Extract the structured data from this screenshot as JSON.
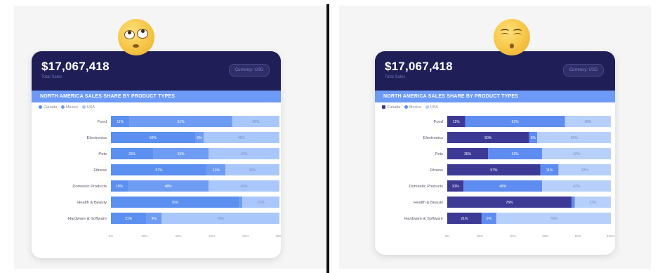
{
  "cards": [
    {
      "total": "$17,067,418",
      "total_label": "Total Sales",
      "filter_label": "Currency: USD",
      "subtitle": "NORTH AMERICA SALES SHARE BY PRODUCT TYPES",
      "legend": [
        "Canada",
        "Mexico",
        "USA"
      ],
      "colors": [
        "#5b8ff0",
        "#6f9cf3",
        "#a9c7fb"
      ]
    },
    {
      "total": "$17,067,418",
      "total_label": "Total Sales",
      "filter_label": "Currency: USD",
      "subtitle": "NORTH AMERICA SALES SHARE BY PRODUCT TYPES",
      "legend": [
        "Canada",
        "Mexico",
        "USA"
      ],
      "colors": [
        "#3d3a96",
        "#5f8cf0",
        "#b6d0fb"
      ]
    }
  ],
  "chart_data": {
    "type": "bar",
    "stacked": "percent",
    "orientation": "horizontal",
    "categories": [
      "Food",
      "Electronics",
      "Pets",
      "Fitness",
      "Domestic Products",
      "Health & Beauty",
      "Hardware & Software"
    ],
    "series": [
      {
        "name": "Canada",
        "values": [
          11,
          50,
          25,
          57,
          10,
          76,
          21
        ]
      },
      {
        "name": "Mexico",
        "values": [
          61,
          5,
          33,
          11,
          48,
          2,
          9
        ]
      },
      {
        "name": "USA",
        "values": [
          28,
          45,
          42,
          32,
          42,
          22,
          70
        ]
      }
    ],
    "xlim": [
      0,
      100
    ],
    "xticks": [
      "0%",
      "20%",
      "40%",
      "60%",
      "80%",
      "100%"
    ],
    "grid": false,
    "legend_position": "top-left"
  }
}
